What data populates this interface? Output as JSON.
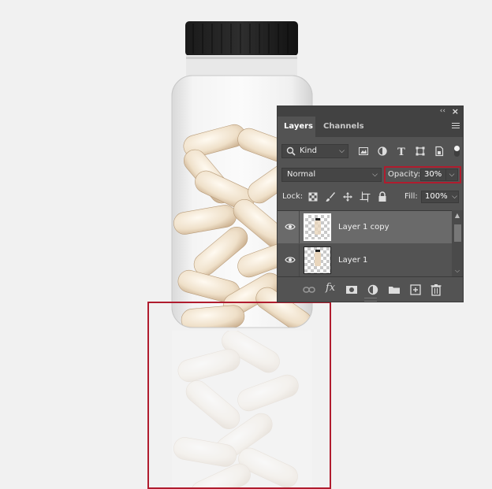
{
  "panel": {
    "tabs": [
      "Layers",
      "Channels"
    ],
    "filter_kind": "Kind",
    "blend_mode": "Normal",
    "opacity_label": "Opacity:",
    "opacity_value": "30%",
    "lock_label": "Lock:",
    "fill_label": "Fill:",
    "fill_value": "100%",
    "layers": [
      {
        "name": "Layer 1 copy",
        "selected": true,
        "visible": true
      },
      {
        "name": "Layer 1",
        "selected": false,
        "visible": true
      }
    ],
    "footer_fx": "fx"
  },
  "colors": {
    "highlight": "#b01c2e",
    "panel_bg": "#535353",
    "canvas_bg": "#f1f1f1"
  },
  "icons": [
    "collapse-icon",
    "close-icon",
    "panel-menu-icon",
    "search-icon",
    "image-filter-icon",
    "adjustment-filter-icon",
    "type-filter-icon",
    "shape-filter-icon",
    "smart-object-filter-icon",
    "filter-toggle-icon",
    "lock-transparent-icon",
    "lock-paint-icon",
    "lock-move-icon",
    "lock-artboard-icon",
    "lock-all-icon",
    "eye-icon",
    "link-icon",
    "add-mask-icon",
    "new-adjustment-icon",
    "new-group-icon",
    "new-layer-icon",
    "trash-icon"
  ]
}
